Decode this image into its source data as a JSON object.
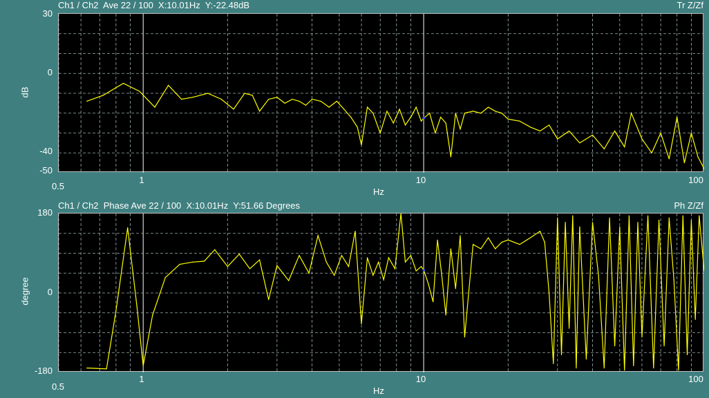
{
  "colors": {
    "background": "#3f7f7f",
    "plot_bg": "#000000",
    "trace": "#ffff00",
    "grid": "#9fb5b5",
    "cursor": "#ffffff"
  },
  "chart_data": [
    {
      "type": "line",
      "header_left": "Ch1 / Ch2  Ave 22 / 100  X:10.01Hz  Y:-22.48dB",
      "header_right": "Tr Z/Zf",
      "xlabel": "Hz",
      "ylabel": "dB",
      "x_scale": "log",
      "xlim": [
        0.5,
        100
      ],
      "ylim": [
        -50,
        30
      ],
      "x_ticks": [
        "0.5",
        "1",
        "10",
        "100"
      ],
      "y_ticks": [
        "30",
        "0",
        "-40",
        "-50"
      ],
      "cursor_x": 10.01,
      "cursor_y": -22.48,
      "series": [
        {
          "x": [
            0.63,
            0.72,
            0.85,
            0.97,
            1.1,
            1.23,
            1.37,
            1.5,
            1.7,
            1.9,
            2.1,
            2.3,
            2.45,
            2.6,
            2.8,
            3.0,
            3.2,
            3.4,
            3.6,
            3.8,
            4.0,
            4.3,
            4.6,
            4.9,
            5.2,
            5.5,
            5.8,
            6.0,
            6.3,
            6.6,
            7.0,
            7.4,
            7.8,
            8.2,
            8.6,
            9.0,
            9.4,
            9.8,
            10.01,
            10.5,
            11,
            11.5,
            12,
            12.5,
            13,
            13.5,
            14,
            15,
            16,
            17,
            18,
            19,
            20,
            22,
            24,
            26,
            28,
            30,
            33,
            36,
            40,
            44,
            48,
            52,
            55,
            60,
            65,
            70,
            75,
            80,
            85,
            90,
            95,
            100
          ],
          "values": [
            -14,
            -11,
            -5,
            -9,
            -17,
            -6,
            -13,
            -12,
            -10,
            -13,
            -18,
            -10,
            -11,
            -19,
            -13,
            -12,
            -15,
            -13,
            -14,
            -16,
            -13,
            -14,
            -17,
            -14,
            -18,
            -22,
            -27,
            -36,
            -17,
            -20,
            -30,
            -19,
            -25,
            -18,
            -26,
            -22,
            -17,
            -24,
            -22.5,
            -20,
            -30,
            -22,
            -25,
            -42,
            -20,
            -28,
            -20,
            -19,
            -20,
            -17,
            -19,
            -20,
            -23,
            -24,
            -27,
            -29,
            -26,
            -33,
            -29,
            -35,
            -31,
            -38,
            -29,
            -37,
            -20,
            -33,
            -40,
            -30,
            -43,
            -22,
            -45,
            -30,
            -42,
            -48
          ]
        }
      ]
    },
    {
      "type": "line",
      "header_left": "Ch1 / Ch2  Phase Ave 22 / 100  X:10.01Hz  Y:51.66 Degrees",
      "header_right": "Ph Z/Zf",
      "xlabel": "Hz",
      "ylabel": "degree",
      "x_scale": "log",
      "xlim": [
        0.5,
        100
      ],
      "ylim": [
        -180,
        180
      ],
      "x_ticks": [
        "0.5",
        "1",
        "10",
        "100"
      ],
      "y_ticks": [
        "180",
        "0",
        "-180"
      ],
      "cursor_x": 10.01,
      "cursor_y": 51.66,
      "series": [
        {
          "x": [
            0.63,
            0.74,
            0.8,
            0.88,
            0.95,
            1.0,
            1.08,
            1.2,
            1.35,
            1.5,
            1.65,
            1.8,
            2.0,
            2.2,
            2.4,
            2.6,
            2.8,
            3.0,
            3.3,
            3.6,
            3.9,
            4.2,
            4.5,
            4.8,
            5.1,
            5.4,
            5.7,
            6.0,
            6.3,
            6.6,
            6.9,
            7.2,
            7.5,
            7.9,
            8.3,
            8.6,
            9.0,
            9.4,
            9.8,
            10.01,
            10.4,
            10.8,
            11.2,
            11.6,
            12,
            12.5,
            13,
            13.5,
            14,
            15,
            16,
            17,
            18,
            19,
            20,
            22,
            24,
            26,
            27,
            28,
            29,
            30,
            31,
            32,
            33,
            34,
            35,
            36,
            38,
            40,
            42,
            44,
            46,
            48,
            50,
            52,
            54,
            56,
            58,
            60,
            63,
            66,
            69,
            72,
            75,
            78,
            81,
            84,
            87,
            90,
            93,
            96,
            100
          ],
          "values": [
            -170,
            -172,
            -40,
            148,
            -30,
            -165,
            -50,
            35,
            65,
            70,
            72,
            98,
            60,
            88,
            55,
            75,
            -15,
            62,
            28,
            85,
            45,
            130,
            70,
            40,
            85,
            60,
            140,
            -70,
            80,
            40,
            70,
            30,
            80,
            55,
            180,
            70,
            85,
            50,
            60,
            51.66,
            20,
            -20,
            120,
            40,
            -50,
            100,
            10,
            130,
            -100,
            110,
            100,
            125,
            100,
            115,
            120,
            110,
            125,
            140,
            115,
            0,
            -160,
            170,
            -140,
            160,
            -80,
            175,
            -170,
            150,
            -150,
            160,
            40,
            -170,
            170,
            -120,
            150,
            -175,
            175,
            -165,
            160,
            -100,
            175,
            -170,
            165,
            -120,
            170,
            30,
            -175,
            175,
            -140,
            165,
            -60,
            175,
            50
          ]
        }
      ]
    }
  ]
}
